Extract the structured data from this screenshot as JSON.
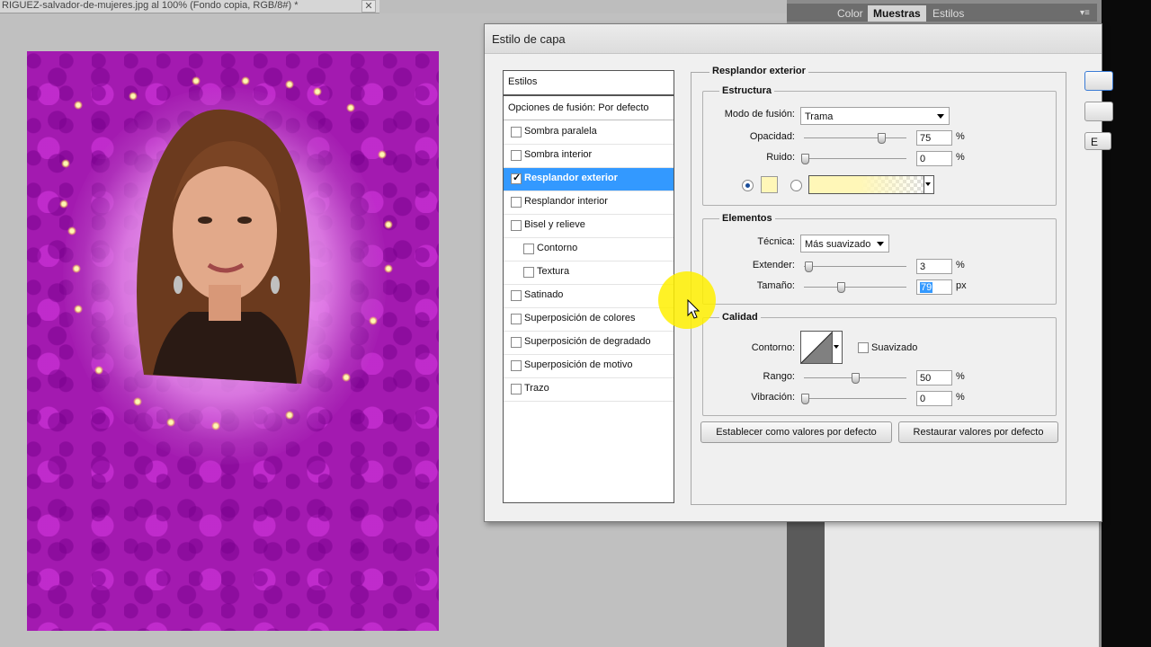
{
  "document": {
    "tab_title": "RIGUEZ-salvador-de-mujeres.jpg al 100% (Fondo copia, RGB/8#) *",
    "close_glyph": "✕"
  },
  "panels": {
    "tabs": [
      {
        "label": "Color"
      },
      {
        "label": "Muestras"
      },
      {
        "label": "Estilos"
      }
    ]
  },
  "dialog": {
    "title": "Estilo de capa",
    "styles_header": "Estilos",
    "blend_options": "Opciones de fusión: Por defecto",
    "style_items": [
      {
        "label": "Sombra paralela",
        "checked": false
      },
      {
        "label": "Sombra interior",
        "checked": false
      },
      {
        "label": "Resplandor exterior",
        "checked": true
      },
      {
        "label": "Resplandor interior",
        "checked": false
      },
      {
        "label": "Bisel y relieve",
        "checked": false
      },
      {
        "label": "Contorno",
        "checked": false
      },
      {
        "label": "Textura",
        "checked": false
      },
      {
        "label": "Satinado",
        "checked": false
      },
      {
        "label": "Superposición de colores",
        "checked": false
      },
      {
        "label": "Superposición de degradado",
        "checked": false
      },
      {
        "label": "Superposición de motivo",
        "checked": false
      },
      {
        "label": "Trazo",
        "checked": false
      }
    ],
    "section_title": "Resplandor exterior",
    "estructura": {
      "title": "Estructura",
      "blend_mode_label": "Modo de fusión:",
      "blend_mode_value": "Trama",
      "opacity_label": "Opacidad:",
      "opacity_value": "75",
      "opacity_unit": "%",
      "noise_label": "Ruido:",
      "noise_value": "0",
      "noise_unit": "%",
      "glow_color": "#fff7b8"
    },
    "elementos": {
      "title": "Elementos",
      "technique_label": "Técnica:",
      "technique_value": "Más suavizado",
      "spread_label": "Extender:",
      "spread_value": "3",
      "spread_unit": "%",
      "size_label": "Tamaño:",
      "size_value": "79",
      "size_unit": "px"
    },
    "calidad": {
      "title": "Calidad",
      "contour_label": "Contorno:",
      "antialias_label": "Suavizado",
      "range_label": "Rango:",
      "range_value": "50",
      "range_unit": "%",
      "jitter_label": "Vibración:",
      "jitter_value": "0",
      "jitter_unit": "%"
    },
    "buttons": {
      "make_default": "Establecer como valores por defecto",
      "reset_default": "Restaurar valores por defecto"
    },
    "side_button_partial": "E"
  }
}
